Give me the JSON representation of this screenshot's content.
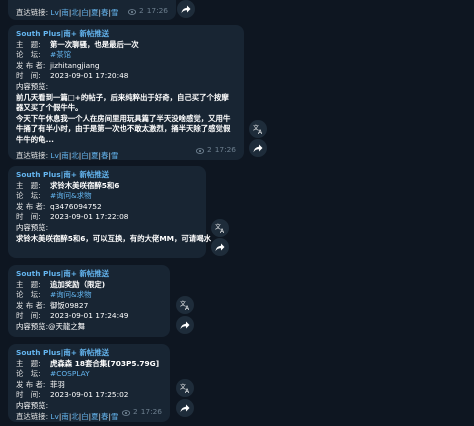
{
  "top_partial": {
    "link_label": "直达链接:",
    "links": [
      "Lv",
      "南",
      "北",
      "白",
      "夏",
      "春",
      "雪"
    ],
    "views": "2",
    "time": "17:26"
  },
  "messages": [
    {
      "channel": "South Plus|南+ 新帖推送",
      "title_lbl": "主　题:",
      "title": "第一次聊骚，也是最后一次",
      "forum_lbl": "论　坛:",
      "forum": "#茶馆",
      "author_lbl": "发 布 者:",
      "author": "jizhitangjiang",
      "time_lbl": "时　间:",
      "time": "2023-09-01 17:20:48",
      "preview_lbl": "内容预览:",
      "preview": [
        "前几天看到一篇□+的帖子，后来纯粹出于好奇，自己买了个按摩器又买了个假牛牛。",
        "今天下午休息我一个人在房间里用玩具篇了半天没啥感觉，又用牛牛捅了有半小时，由于是第一次也不敢太激烈，捅半天除了感觉假牛牛的龟..."
      ],
      "link_label": "直达链接:",
      "links": [
        "Lv",
        "南",
        "北",
        "白",
        "夏",
        "春",
        "雪"
      ],
      "views": "2",
      "stamp": "17:26"
    },
    {
      "channel": "South Plus|南+ 新帖推送",
      "title_lbl": "主　题:",
      "title": "求铃木美咲宿醉5和6",
      "forum_lbl": "论　坛:",
      "forum": "#询问&求物",
      "author_lbl": "发 布 者:",
      "author": "q3476094752",
      "time_lbl": "时　间:",
      "time": "2023-09-01 17:22:08",
      "preview_lbl": "内容预览:",
      "preview": [
        "求铃木美咲宿醉5和6，可以互换，有的大佬MM，可请喝水"
      ],
      "link_label": "直达链接:",
      "links": [
        "Lv",
        "南",
        "北",
        "白",
        "夏",
        "春",
        "雪"
      ],
      "views": "2",
      "stamp": "17:26"
    },
    {
      "channel": "South Plus|南+ 新帖推送",
      "title_lbl": "主　题:",
      "title": "追加奖励（限定)",
      "forum_lbl": "论　坛:",
      "forum": "#询问&求物",
      "author_lbl": "发 布 者:",
      "author": "御饭09827",
      "time_lbl": "时　间:",
      "time": "2023-09-01 17:24:49",
      "preview_lbl": "内容预览:",
      "preview": [
        "@天龍之舞"
      ],
      "link_label": "直达链接:",
      "links": [
        "Lv",
        "南",
        "北",
        "白",
        "夏",
        "春",
        "雪"
      ],
      "views": "2",
      "stamp": "17:26"
    },
    {
      "channel": "South Plus|南+ 新帖推送",
      "title_lbl": "主　题:",
      "title": "虎森森 18套合集[703P5.79G]",
      "forum_lbl": "论　坛:",
      "forum": "#COSPLAY",
      "author_lbl": "发 布 者:",
      "author": "菲羽",
      "time_lbl": "时　间:",
      "time": "2023-09-01 17:25:02",
      "preview_lbl": "内容预览:",
      "preview": [],
      "link_label": "直达链接:",
      "links": [
        "Lv",
        "南",
        "北",
        "白",
        "夏",
        "春",
        "雪"
      ],
      "views": "2",
      "stamp": "17:26"
    }
  ]
}
